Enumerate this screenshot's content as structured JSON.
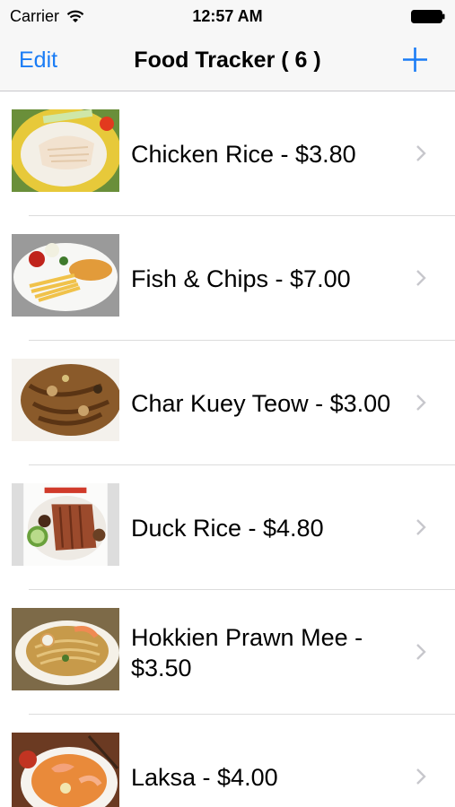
{
  "status": {
    "carrier": "Carrier",
    "time": "12:57 AM"
  },
  "nav": {
    "edit_label": "Edit",
    "title": "Food Tracker ( 6 )",
    "accent_color": "#1a7cf5"
  },
  "items": [
    {
      "label": "Chicken Rice - $3.80",
      "icon": "chicken-rice-photo"
    },
    {
      "label": "Fish & Chips - $7.00",
      "icon": "fish-and-chips-photo"
    },
    {
      "label": "Char Kuey Teow - $3.00",
      "icon": "char-kuey-teow-photo"
    },
    {
      "label": "Duck Rice - $4.80",
      "icon": "duck-rice-photo"
    },
    {
      "label": "Hokkien Prawn Mee - $3.50",
      "icon": "hokkien-prawn-mee-photo"
    },
    {
      "label": "Laksa - $4.00",
      "icon": "laksa-photo"
    }
  ]
}
